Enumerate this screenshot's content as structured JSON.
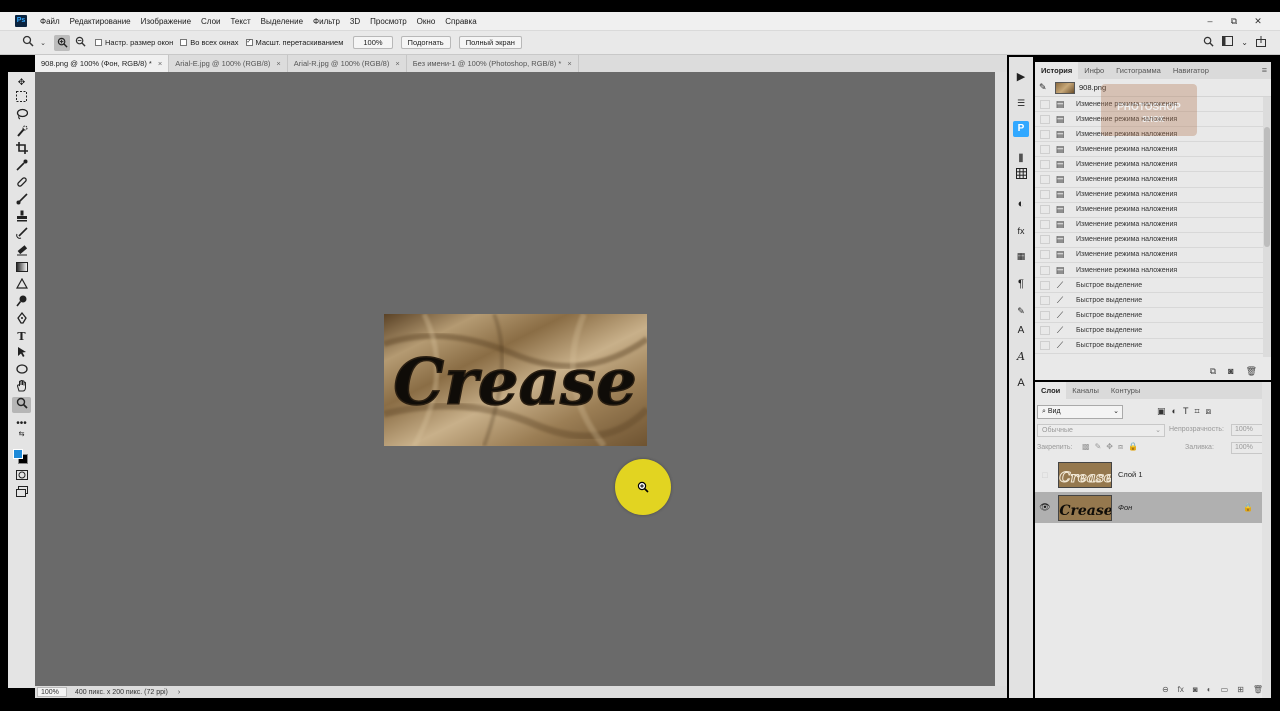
{
  "app": {
    "logo": "Ps"
  },
  "menu": [
    "Файл",
    "Редактирование",
    "Изображение",
    "Слои",
    "Текст",
    "Выделение",
    "Фильтр",
    "3D",
    "Просмотр",
    "Окно",
    "Справка"
  ],
  "window_controls": [
    "–",
    "⧉",
    "✕"
  ],
  "options": {
    "resize_windows": "Настр. размер окон",
    "all_windows": "Во всех окнах",
    "scrubby_zoom": "Масшт. перетаскиванием",
    "zoom_value": "100%",
    "fit_button": "Подогнать",
    "fullscreen_button": "Полный экран"
  },
  "tabs": [
    {
      "label": "908.png @ 100% (Фон, RGB/8) *",
      "active": true
    },
    {
      "label": "Arial-E.jpg @ 100% (RGB/8)",
      "active": false
    },
    {
      "label": "Arial-R.jpg @ 100% (RGB/8)",
      "active": false
    },
    {
      "label": "Без имени-1 @ 100% (Photoshop, RGB/8) *",
      "active": false
    }
  ],
  "canvas": {
    "text": "Crease",
    "colors": {
      "background": "#6a6a6a",
      "cursor_highlight": "#e2d421",
      "foreground_swatch": "#1e8ad8"
    }
  },
  "status": {
    "zoom": "100%",
    "info": "400 пикс. x 200 пикс. (72 ppi)",
    "arrow": "›"
  },
  "history": {
    "tabs": [
      "История",
      "Инфо",
      "Гистограмма",
      "Навигатор"
    ],
    "snapshot": "908.png",
    "items": [
      "Изменение режима наложения",
      "Изменение режима наложения",
      "Изменение режима наложения",
      "Изменение режима наложения",
      "Изменение режима наложения",
      "Изменение режима наложения",
      "Изменение режима наложения",
      "Изменение режима наложения",
      "Изменение режима наложения",
      "Изменение режима наложения",
      "Изменение режима наложения",
      "Изменение режима наложения",
      "Быстрое выделение",
      "Быстрое выделение",
      "Быстрое выделение",
      "Быстрое выделение",
      "Быстрое выделение"
    ],
    "item_icons": [
      "doc-icon",
      "doc-icon",
      "doc-icon",
      "doc-icon",
      "doc-icon",
      "doc-icon",
      "doc-icon",
      "doc-icon",
      "doc-icon",
      "doc-icon",
      "doc-icon",
      "doc-icon",
      "quick-selection-icon",
      "quick-selection-icon",
      "quick-selection-icon",
      "quick-selection-icon",
      "quick-selection-icon"
    ]
  },
  "watermark": {
    "line1": "PHOTOSHOP",
    "line2": "ЗНОК"
  },
  "layers": {
    "tabs": [
      "Слои",
      "Каналы",
      "Контуры"
    ],
    "filter_label": "Вид",
    "blend_mode": "Обычные",
    "opacity_label": "Непрозрачность:",
    "opacity_value": "100%",
    "lock_label": "Закрепить:",
    "fill_label": "Заливка:",
    "fill_value": "100%",
    "items": [
      {
        "name": "Слой 1",
        "visible": false,
        "selected": false
      },
      {
        "name": "Фон",
        "visible": true,
        "selected": true,
        "locked": true
      }
    ],
    "thumb_text": "Crease"
  }
}
